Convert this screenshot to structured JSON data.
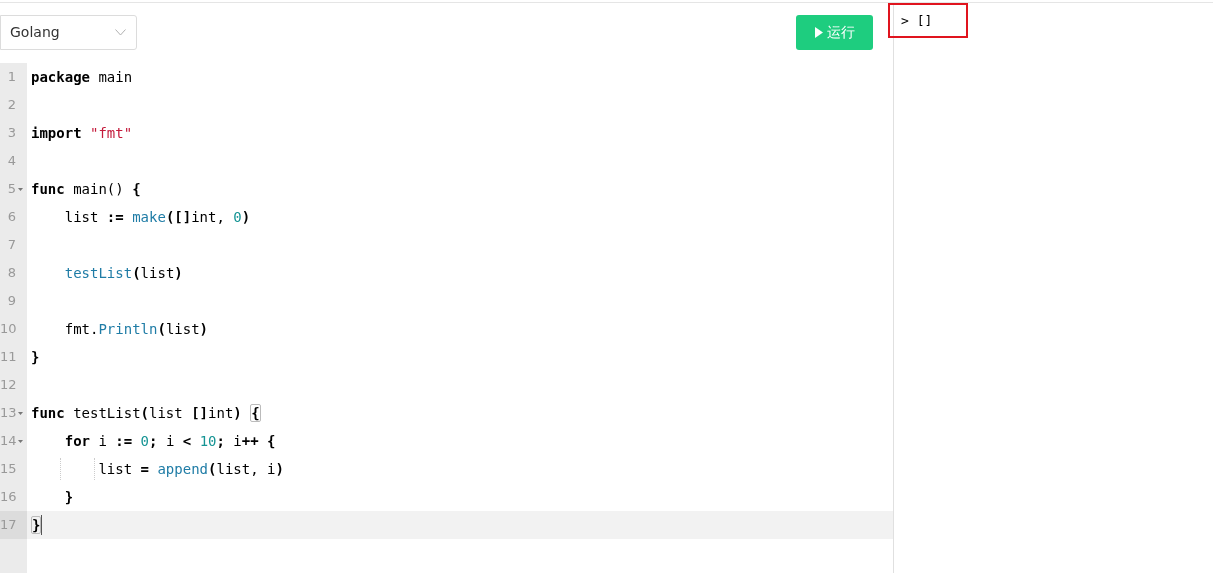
{
  "language_select": {
    "value": "Golang"
  },
  "run_button": {
    "label": "运行"
  },
  "editor": {
    "lines": [
      {
        "number": "1",
        "foldable": false,
        "active": false,
        "cursor": false,
        "guides": false,
        "tokens": [
          {
            "kind": "keyword",
            "text": "package"
          },
          {
            "kind": "plain",
            "text": " main"
          }
        ]
      },
      {
        "number": "2",
        "foldable": false,
        "active": false,
        "cursor": false,
        "guides": false
      },
      {
        "number": "3",
        "foldable": false,
        "active": false,
        "cursor": false,
        "guides": false,
        "tokens": [
          {
            "kind": "keyword",
            "text": "import"
          },
          {
            "kind": "string",
            "text": " \"fmt\""
          }
        ]
      },
      {
        "number": "4",
        "foldable": false,
        "active": false,
        "cursor": false,
        "guides": false
      },
      {
        "number": "5",
        "foldable": true,
        "active": false,
        "cursor": false,
        "guides": false,
        "tokens": [
          {
            "kind": "keyword",
            "text": "func"
          },
          {
            "kind": "plain",
            "text": " main() "
          },
          {
            "kind": "keyword",
            "text": "{"
          }
        ]
      },
      {
        "number": "6",
        "foldable": false,
        "active": false,
        "cursor": false,
        "guides": false,
        "tokens": [
          {
            "kind": "plain",
            "text": "    list "
          },
          {
            "kind": "keyword",
            "text": ":="
          },
          {
            "kind": "function",
            "text": " make"
          },
          {
            "kind": "keyword",
            "text": "([]"
          },
          {
            "kind": "plain",
            "text": "int, "
          },
          {
            "kind": "number",
            "text": "0"
          },
          {
            "kind": "keyword",
            "text": ")"
          }
        ]
      },
      {
        "number": "7",
        "foldable": false,
        "active": false,
        "cursor": false,
        "guides": false
      },
      {
        "number": "8",
        "foldable": false,
        "active": false,
        "cursor": false,
        "guides": false,
        "tokens": [
          {
            "kind": "function",
            "text": "    testList"
          },
          {
            "kind": "keyword",
            "text": "("
          },
          {
            "kind": "plain",
            "text": "list"
          },
          {
            "kind": "keyword",
            "text": ")"
          }
        ]
      },
      {
        "number": "9",
        "foldable": false,
        "active": false,
        "cursor": false,
        "guides": false
      },
      {
        "number": "10",
        "foldable": false,
        "active": false,
        "cursor": false,
        "guides": false,
        "tokens": [
          {
            "kind": "plain",
            "text": "    fmt."
          },
          {
            "kind": "function",
            "text": "Println"
          },
          {
            "kind": "keyword",
            "text": "("
          },
          {
            "kind": "plain",
            "text": "list"
          },
          {
            "kind": "keyword",
            "text": ")"
          }
        ]
      },
      {
        "number": "11",
        "foldable": false,
        "active": false,
        "cursor": false,
        "guides": false,
        "tokens": [
          {
            "kind": "keyword",
            "text": "}"
          }
        ]
      },
      {
        "number": "12",
        "foldable": false,
        "active": false,
        "cursor": false,
        "guides": false
      },
      {
        "number": "13",
        "foldable": true,
        "active": false,
        "cursor": false,
        "guides": false,
        "tokens": [
          {
            "kind": "keyword",
            "text": "func"
          },
          {
            "kind": "plain",
            "text": " testList"
          },
          {
            "kind": "keyword",
            "text": "("
          },
          {
            "kind": "plain",
            "text": "list "
          },
          {
            "kind": "keyword",
            "text": "[]"
          },
          {
            "kind": "plain",
            "text": "int"
          },
          {
            "kind": "keyword",
            "text": ") "
          },
          {
            "kind": "matched-bracket",
            "text": "{"
          }
        ]
      },
      {
        "number": "14",
        "foldable": true,
        "active": false,
        "cursor": false,
        "guides": false,
        "tokens": [
          {
            "kind": "keyword",
            "text": "    for"
          },
          {
            "kind": "plain",
            "text": " i "
          },
          {
            "kind": "keyword",
            "text": ":="
          },
          {
            "kind": "number",
            "text": " 0"
          },
          {
            "kind": "keyword",
            "text": ";"
          },
          {
            "kind": "plain",
            "text": " i "
          },
          {
            "kind": "keyword",
            "text": "<"
          },
          {
            "kind": "number",
            "text": " 10"
          },
          {
            "kind": "keyword",
            "text": ";"
          },
          {
            "kind": "plain",
            "text": " i"
          },
          {
            "kind": "keyword",
            "text": "++ {"
          }
        ]
      },
      {
        "number": "15",
        "foldable": false,
        "active": false,
        "cursor": false,
        "guides": true,
        "tokens": [
          {
            "kind": "plain",
            "text": "        list "
          },
          {
            "kind": "keyword",
            "text": "="
          },
          {
            "kind": "function",
            "text": " append"
          },
          {
            "kind": "keyword",
            "text": "("
          },
          {
            "kind": "plain",
            "text": "list, i"
          },
          {
            "kind": "keyword",
            "text": ")"
          }
        ]
      },
      {
        "number": "16",
        "foldable": false,
        "active": false,
        "cursor": false,
        "guides": false,
        "tokens": [
          {
            "kind": "keyword",
            "text": "    }"
          }
        ]
      },
      {
        "number": "17",
        "foldable": false,
        "active": true,
        "cursor": true,
        "guides": false,
        "tokens": [
          {
            "kind": "matched-bracket",
            "text": "}"
          }
        ]
      }
    ]
  },
  "output": {
    "text": "> []",
    "highlighted": true
  }
}
